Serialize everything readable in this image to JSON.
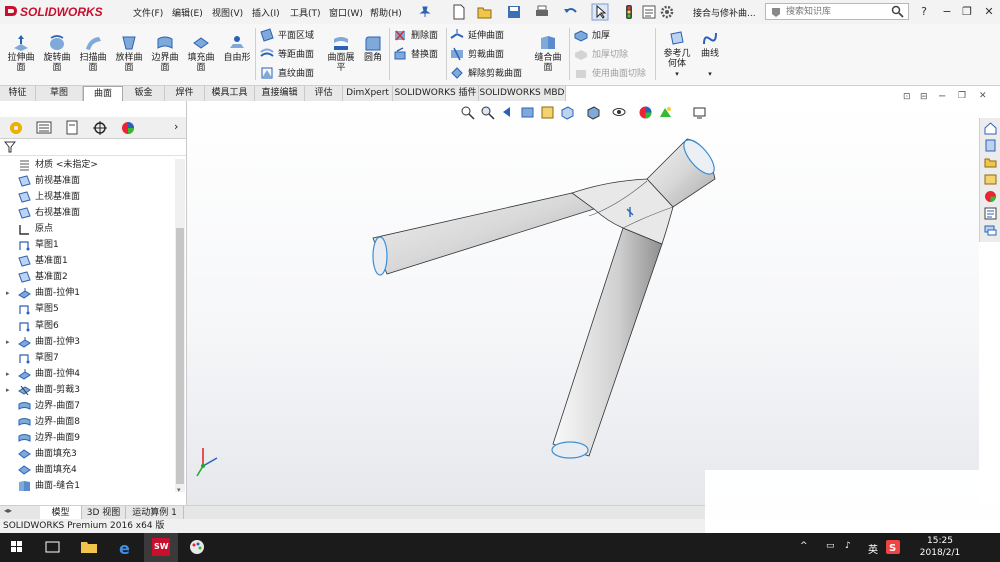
{
  "app": {
    "name": "SOLIDWORKS",
    "document_title": "接合与修补曲..."
  },
  "menu": [
    "文件(F)",
    "编辑(E)",
    "视图(V)",
    "插入(I)",
    "工具(T)",
    "窗口(W)",
    "帮助(H)"
  ],
  "search": {
    "placeholder": "搜索知识库"
  },
  "ribbon": {
    "big": [
      {
        "label": "拉伸曲面",
        "icon": "extruded-surface-icon"
      },
      {
        "label": "旋转曲面",
        "icon": "revolved-surface-icon"
      },
      {
        "label": "扫描曲面",
        "icon": "swept-surface-icon"
      },
      {
        "label": "放样曲面",
        "icon": "lofted-surface-icon"
      },
      {
        "label": "边界曲面",
        "icon": "boundary-surface-icon"
      },
      {
        "label": "填充曲面",
        "icon": "filled-surface-icon"
      },
      {
        "label": "自由形",
        "icon": "freeform-icon"
      }
    ],
    "col1": [
      "平面区域",
      "等距曲面",
      "直纹曲面"
    ],
    "mid_big": [
      {
        "label": "曲面展平",
        "icon": "surface-flatten-icon"
      },
      {
        "label": "圆角",
        "icon": "fillet-icon"
      }
    ],
    "col2": [
      "删除面",
      "替换面"
    ],
    "col3": [
      "延伸曲面",
      "剪裁曲面",
      "解除剪裁曲面"
    ],
    "knit": {
      "label": "缝合曲面",
      "icon": "knit-surface-icon"
    },
    "col4": [
      {
        "label": "加厚",
        "enabled": true
      },
      {
        "label": "加厚切除",
        "enabled": false
      },
      {
        "label": "使用曲面切除",
        "enabled": false
      }
    ],
    "ref_geom": "参考几何体",
    "curves": "曲线"
  },
  "tabs": [
    "特征",
    "草图",
    "曲面",
    "钣金",
    "焊件",
    "模具工具",
    "直接编辑",
    "评估",
    "DimXpert",
    "SOLIDWORKS 插件",
    "SOLIDWORKS MBD"
  ],
  "active_tab": "曲面",
  "tree": [
    {
      "label": "材质 <未指定>",
      "icon": "material-icon",
      "expandable": false
    },
    {
      "label": "前视基准面",
      "icon": "plane-icon",
      "expandable": false
    },
    {
      "label": "上视基准面",
      "icon": "plane-icon",
      "expandable": false
    },
    {
      "label": "右视基准面",
      "icon": "plane-icon",
      "expandable": false
    },
    {
      "label": "原点",
      "icon": "origin-icon",
      "expandable": false
    },
    {
      "label": "草图1",
      "icon": "sketch-icon",
      "expandable": false
    },
    {
      "label": "基准面1",
      "icon": "plane-icon",
      "expandable": false
    },
    {
      "label": "基准面2",
      "icon": "plane-icon",
      "expandable": false
    },
    {
      "label": "曲面-拉伸1",
      "icon": "surface-extrude-icon",
      "expandable": true
    },
    {
      "label": "草图5",
      "icon": "sketch-icon",
      "expandable": false
    },
    {
      "label": "草图6",
      "icon": "sketch-icon",
      "expandable": false
    },
    {
      "label": "曲面-拉伸3",
      "icon": "surface-extrude-icon",
      "expandable": true
    },
    {
      "label": "草图7",
      "icon": "sketch-icon",
      "expandable": false
    },
    {
      "label": "曲面-拉伸4",
      "icon": "surface-extrude-icon",
      "expandable": true
    },
    {
      "label": "曲面-剪裁3",
      "icon": "surface-trim-icon",
      "expandable": true
    },
    {
      "label": "边界-曲面7",
      "icon": "boundary-surface-icon",
      "expandable": false
    },
    {
      "label": "边界-曲面8",
      "icon": "boundary-surface-icon",
      "expandable": false
    },
    {
      "label": "边界-曲面9",
      "icon": "boundary-surface-icon",
      "expandable": false
    },
    {
      "label": "曲面填充3",
      "icon": "fill-surface-icon",
      "expandable": false
    },
    {
      "label": "曲面填充4",
      "icon": "fill-surface-icon",
      "expandable": false
    },
    {
      "label": "曲面-缝合1",
      "icon": "knit-icon",
      "expandable": false
    }
  ],
  "bottom_tabs": [
    "模型",
    "3D 视图",
    "运动算例 1"
  ],
  "status": "SOLIDWORKS Premium 2016 x64 版",
  "clock": {
    "time": "15:25",
    "date": "2018/2/1"
  },
  "ime": "英",
  "colors": {
    "brand": "#c8102e",
    "model_gray": "#d4d4d4",
    "edge_blue": "#3a8fd6"
  }
}
